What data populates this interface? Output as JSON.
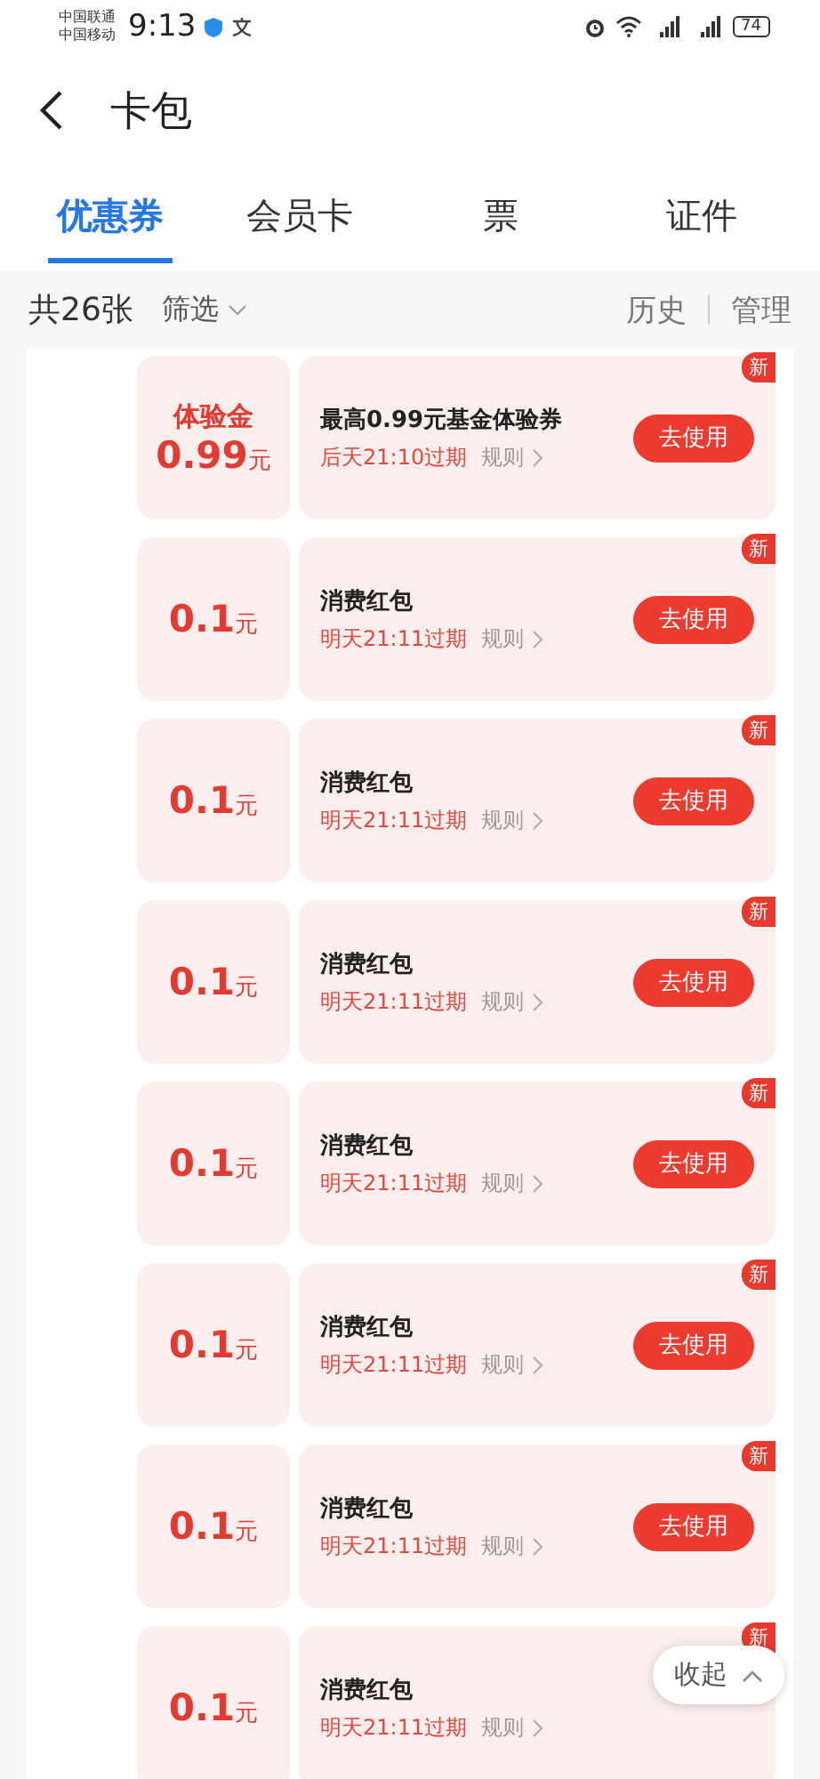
{
  "status_bar": {
    "carriers": [
      "中国联通",
      "中国移动"
    ],
    "time": "9:13",
    "battery": "74"
  },
  "header": {
    "title": "卡包"
  },
  "tabs": [
    {
      "label": "优惠券",
      "selected": true
    },
    {
      "label": "会员卡",
      "selected": false
    },
    {
      "label": "票",
      "selected": false
    },
    {
      "label": "证件",
      "selected": false
    }
  ],
  "toolbar": {
    "count": "共26张",
    "filter": "筛选",
    "history": "历史",
    "manage": "管理"
  },
  "coupons": [
    {
      "kind": "trial",
      "label": "体验金",
      "amount": "0.99",
      "unit": "元",
      "title": "最高0.99元基金体验券",
      "expiry": "后天21:10过期",
      "rules": "规则",
      "button": "去使用",
      "badge": "新"
    },
    {
      "kind": "cash",
      "amount": "0.1",
      "unit": "元",
      "title": "消费红包",
      "expiry": "明天21:11过期",
      "rules": "规则",
      "button": "去使用",
      "badge": "新"
    },
    {
      "kind": "cash",
      "amount": "0.1",
      "unit": "元",
      "title": "消费红包",
      "expiry": "明天21:11过期",
      "rules": "规则",
      "button": "去使用",
      "badge": "新"
    },
    {
      "kind": "cash",
      "amount": "0.1",
      "unit": "元",
      "title": "消费红包",
      "expiry": "明天21:11过期",
      "rules": "规则",
      "button": "去使用",
      "badge": "新"
    },
    {
      "kind": "cash",
      "amount": "0.1",
      "unit": "元",
      "title": "消费红包",
      "expiry": "明天21:11过期",
      "rules": "规则",
      "button": "去使用",
      "badge": "新"
    },
    {
      "kind": "cash",
      "amount": "0.1",
      "unit": "元",
      "title": "消费红包",
      "expiry": "明天21:11过期",
      "rules": "规则",
      "button": "去使用",
      "badge": "新"
    },
    {
      "kind": "cash",
      "amount": "0.1",
      "unit": "元",
      "title": "消费红包",
      "expiry": "明天21:11过期",
      "rules": "规则",
      "button": "去使用",
      "badge": "新"
    },
    {
      "kind": "cash",
      "amount": "0.1",
      "unit": "元",
      "title": "消费红包",
      "expiry": "明天21:11过期",
      "rules": "规则",
      "badge": "新"
    }
  ],
  "collapse_button": "收起"
}
